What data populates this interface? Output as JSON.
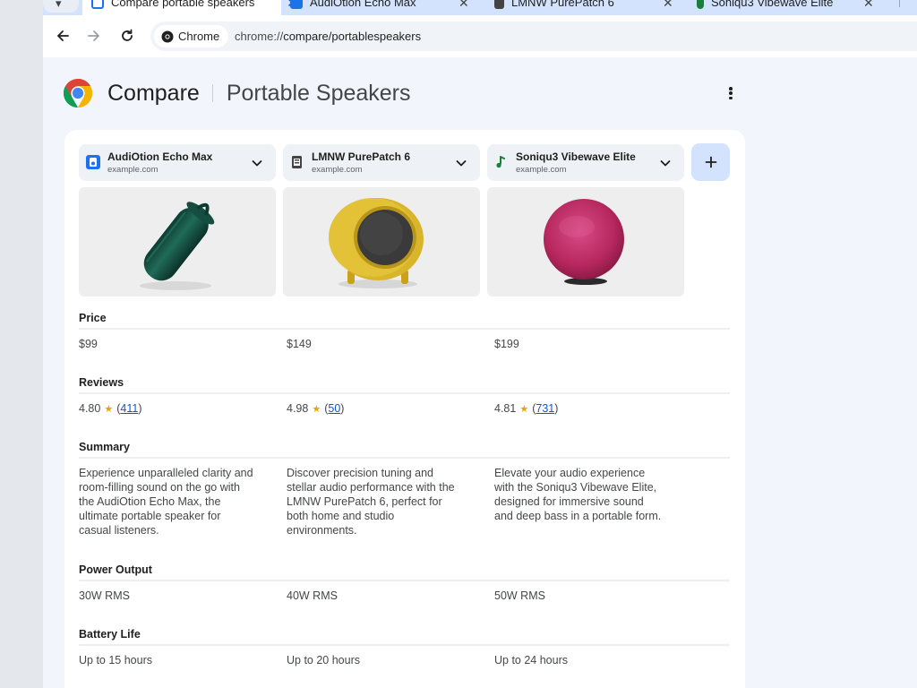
{
  "tabs": [
    {
      "title": "Compare portable speakers",
      "active": true
    },
    {
      "title": "AudiOtion Echo Max",
      "active": false
    },
    {
      "title": "LMNW PurePatch 6",
      "active": false
    },
    {
      "title": "Soniqu3 Vibewave Elite",
      "active": false
    }
  ],
  "toolbar": {
    "chip_label": "Chrome",
    "url_scheme": "chrome://",
    "url_path": "compare/portablespeakers"
  },
  "page": {
    "title": "Compare",
    "subtitle": "Portable Speakers"
  },
  "products": [
    {
      "name": "AudiOtion Echo Max",
      "domain": "example.com",
      "icon": "audiotion-favicon",
      "price": "$99",
      "rating": "4.80",
      "review_count": "411",
      "summary": "Experience unparalleled clarity and room-filling sound on the go with the AudiOtion Echo Max, the ultimate portable speaker for casual listeners.",
      "power_output": "30W RMS",
      "battery_life": "Up to 15 hours",
      "image": "green-cylinder-speaker"
    },
    {
      "name": "LMNW PurePatch 6",
      "domain": "example.com",
      "icon": "lmnw-favicon",
      "price": "$149",
      "rating": "4.98",
      "review_count": "50",
      "summary": "Discover precision tuning and stellar audio performance with the LMNW PurePatch 6, perfect for both home and studio environments.",
      "power_output": "40W RMS",
      "battery_life": "Up to 20 hours",
      "image": "yellow-round-speaker"
    },
    {
      "name": "Soniqu3 Vibewave Elite",
      "domain": "example.com",
      "icon": "music-note-favicon",
      "price": "$199",
      "rating": "4.81",
      "review_count": "731",
      "summary": "Elevate your audio experience with the Soniqu3 Vibewave Elite, designed for immersive sound and deep bass in a portable form.",
      "power_output": "50W RMS",
      "battery_life": "Up to 24 hours",
      "image": "pink-sphere-speaker"
    }
  ],
  "sections": {
    "price": "Price",
    "reviews": "Reviews",
    "summary": "Summary",
    "power_output": "Power Output",
    "battery_life": "Battery Life"
  },
  "colors": {
    "tab_strip": "#d3e3fd",
    "accent_link": "#0b57d0",
    "star": "#e8a600",
    "page_bg": "#f2f5fb"
  }
}
